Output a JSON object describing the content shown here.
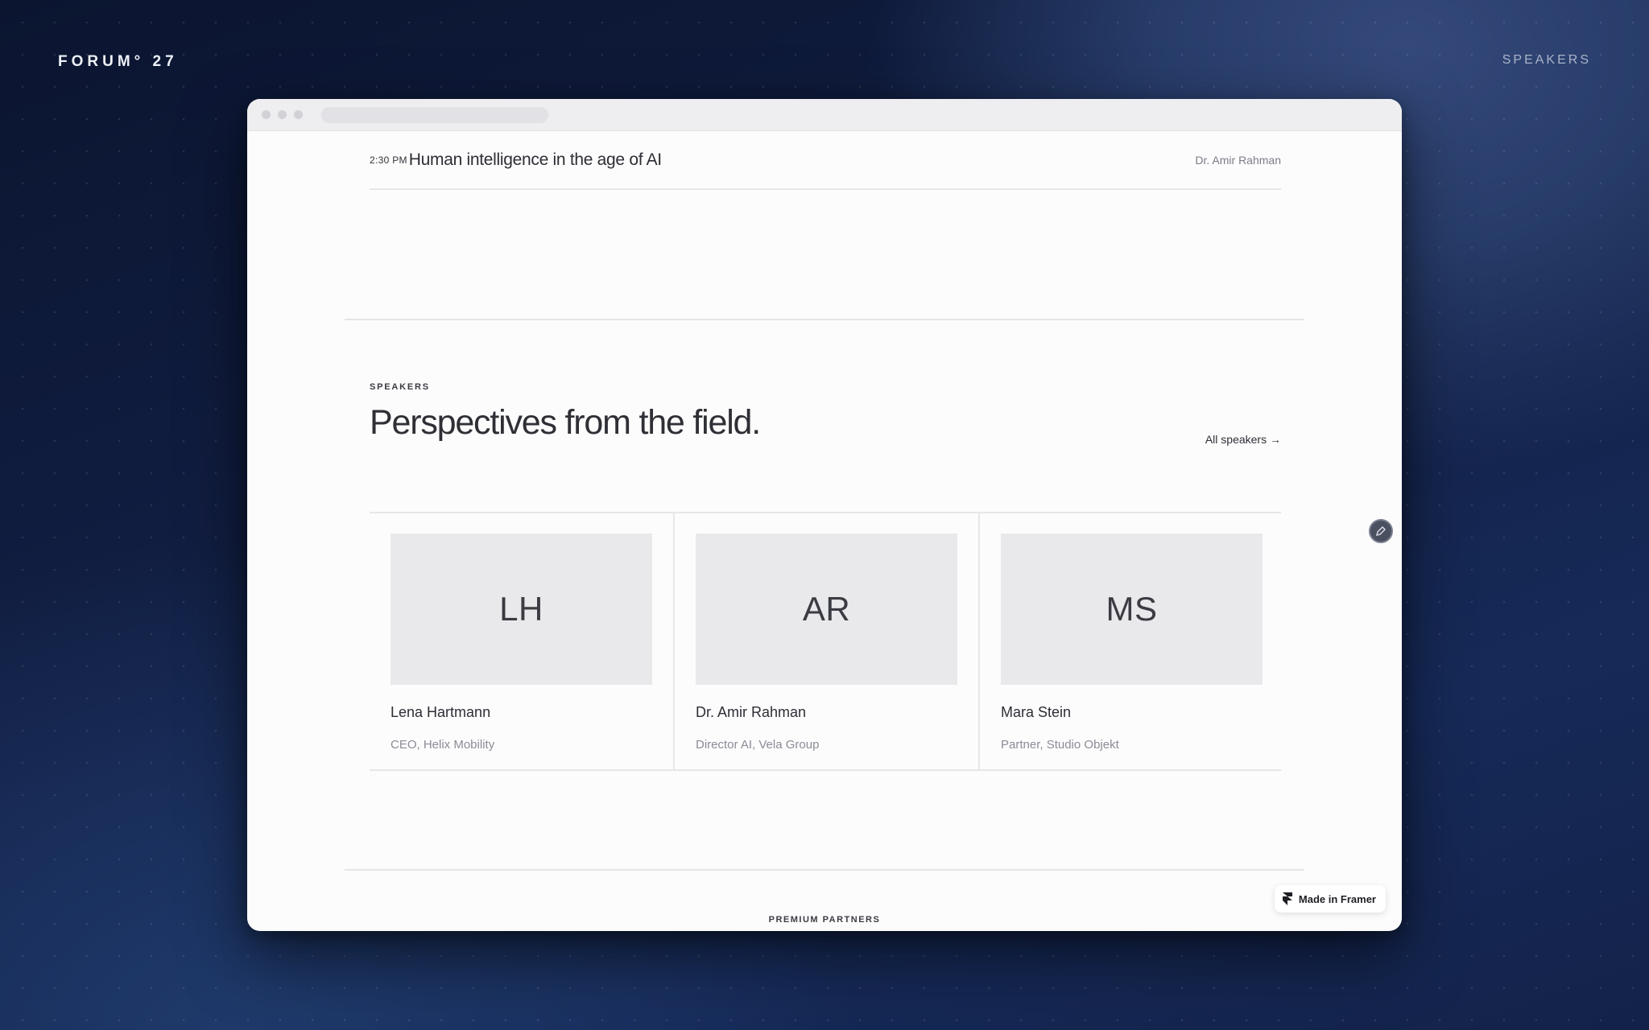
{
  "brand": {
    "name": "FORUM° 27"
  },
  "nav": {
    "speakers_label": "SPEAKERS"
  },
  "agenda": {
    "time": "2:30 PM",
    "title": "Human intelligence in the age of AI",
    "speaker": "Dr. Amir Rahman"
  },
  "speakers_section": {
    "eyebrow": "SPEAKERS",
    "heading": "Perspectives from the field.",
    "all_link": "All speakers →",
    "cards": [
      {
        "initials": "LH",
        "name": "Lena Hartmann",
        "role": "CEO, Helix Mobility"
      },
      {
        "initials": "AR",
        "name": "Dr. Amir Rahman",
        "role": "Director AI, Vela Group"
      },
      {
        "initials": "MS",
        "name": "Mara Stein",
        "role": "Partner, Studio Objekt"
      }
    ]
  },
  "partners": {
    "label": "PREMIUM PARTNERS"
  },
  "badge": {
    "label": "Made in Framer",
    "icon": "framer-logo-icon"
  },
  "edit_button": {
    "icon": "pencil-icon"
  },
  "colors": {
    "background": "#121f44",
    "card_photo": "#e9e9ec",
    "text_dark": "#2d2e34"
  }
}
